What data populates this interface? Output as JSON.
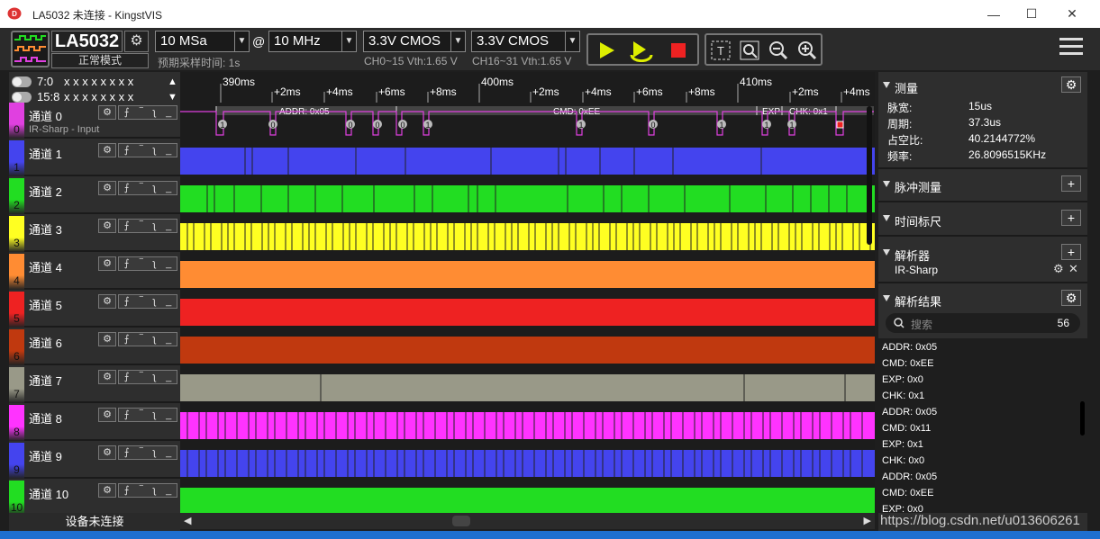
{
  "window": {
    "title": "LA5032 未连接 - KingstVIS",
    "controls": [
      "—",
      "☐",
      "✕"
    ]
  },
  "toolbar": {
    "device": "LA5032",
    "mode": "正常模式",
    "depth": "10 MSa",
    "at": "@",
    "rate": "10 MHz",
    "expected": "预期采样时间: 1s",
    "vth1": "3.3V CMOS",
    "vth1_sub": "CH0~15 Vth:1.65 V",
    "vth2": "3.3V CMOS",
    "vth2_sub": "CH16~31 Vth:1.65 V"
  },
  "groups": [
    {
      "label": "7:0",
      "bits": "x x x x x x x x",
      "arrow": "▲"
    },
    {
      "label": "15:8",
      "bits": "x x x x x x x x",
      "arrow": "▼"
    }
  ],
  "channels": [
    {
      "num": "0",
      "name": "通道 0",
      "desc": "IR-Sharp - Input",
      "color": "#e040e0"
    },
    {
      "num": "1",
      "name": "通道 1",
      "desc": "",
      "color": "#4444ee"
    },
    {
      "num": "2",
      "name": "通道 2",
      "desc": "",
      "color": "#22dd22"
    },
    {
      "num": "3",
      "name": "通道 3",
      "desc": "",
      "color": "#ffff22"
    },
    {
      "num": "4",
      "name": "通道 4",
      "desc": "",
      "color": "#ff8c33"
    },
    {
      "num": "5",
      "name": "通道 5",
      "desc": "",
      "color": "#ee2222"
    },
    {
      "num": "6",
      "name": "通道 6",
      "desc": "",
      "color": "#c0390f"
    },
    {
      "num": "7",
      "name": "通道 7",
      "desc": "",
      "color": "#999988"
    },
    {
      "num": "8",
      "name": "通道 8",
      "desc": "",
      "color": "#ff33ff"
    },
    {
      "num": "9",
      "name": "通道 9",
      "desc": "",
      "color": "#4444ee"
    },
    {
      "num": "10",
      "name": "通道 10",
      "desc": "",
      "color": "#22dd22"
    }
  ],
  "ch_gear": "⚙",
  "ch_trig": [
    "⨍",
    "‾",
    "ʅ",
    "_"
  ],
  "status": "设备未连接",
  "timeline": {
    "labels": [
      "390ms",
      "+2ms",
      "+4ms",
      "+6ms",
      "+8ms",
      "400ms",
      "+2ms",
      "+4ms",
      "+6ms",
      "+8ms",
      "410ms",
      "+2ms",
      "+4ms"
    ]
  },
  "decode": {
    "addr": "ADDR: 0x05",
    "cmd": "CMD: 0xEE",
    "exp": "EXP",
    "chk": "CHK: 0x1",
    "bits": [
      "1",
      "0",
      "0",
      "0",
      "0",
      "1",
      "1",
      "0",
      "1",
      "1",
      "1",
      "0",
      "1"
    ]
  },
  "measure": {
    "title": "测量",
    "rows": [
      {
        "k": "脉宽:",
        "v": "15us"
      },
      {
        "k": "周期:",
        "v": "37.3us"
      },
      {
        "k": "占空比:",
        "v": "40.2144772%"
      },
      {
        "k": "频率:",
        "v": "26.8096515KHz"
      }
    ]
  },
  "sections": {
    "pulse": "脉冲测量",
    "time": "时间标尺",
    "analyzer": "解析器",
    "analyzer_item": "IR-Sharp",
    "results": "解析结果"
  },
  "search": {
    "placeholder": "搜索",
    "count": "56"
  },
  "results": [
    "ADDR: 0x05",
    "CMD: 0xEE",
    "EXP: 0x0",
    "CHK: 0x1",
    "ADDR: 0x05",
    "CMD: 0x11",
    "EXP: 0x1",
    "CHK: 0x0",
    "ADDR: 0x05",
    "CMD: 0xEE",
    "EXP: 0x0"
  ],
  "watermark": "https://blog.csdn.net/u013606261"
}
